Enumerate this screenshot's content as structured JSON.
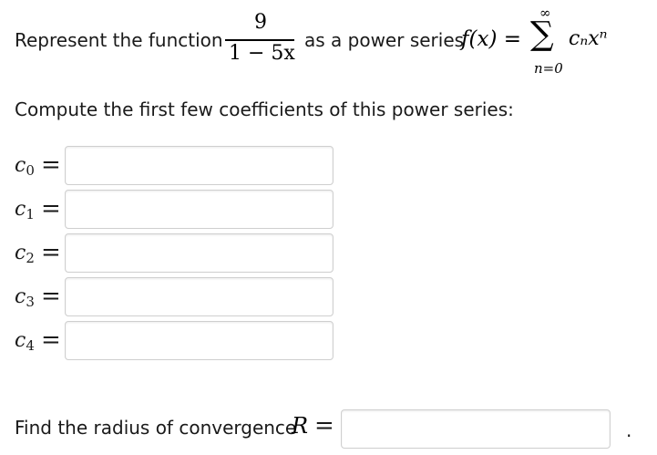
{
  "problem": {
    "intro_text": "Represent the function",
    "numerator": "9",
    "denominator": "1 − 5x",
    "mid_text": "as a power series",
    "series_lhs": "f(x) =",
    "sigma": "∑",
    "sigma_upper": "∞",
    "sigma_lower": "n=0",
    "series_term": "cₙxⁿ",
    "compute_text": "Compute the first few coefficients of this power series:",
    "coefficients": [
      {
        "symbol": "c",
        "index": "0",
        "equals": "=",
        "value": ""
      },
      {
        "symbol": "c",
        "index": "1",
        "equals": "=",
        "value": ""
      },
      {
        "symbol": "c",
        "index": "2",
        "equals": "=",
        "value": ""
      },
      {
        "symbol": "c",
        "index": "3",
        "equals": "=",
        "value": ""
      },
      {
        "symbol": "c",
        "index": "4",
        "equals": "=",
        "value": ""
      }
    ],
    "radius_text": "Find the radius of convergence",
    "radius_symbol": "R",
    "radius_equals": "=",
    "radius_value": "",
    "trailing_period": "."
  }
}
